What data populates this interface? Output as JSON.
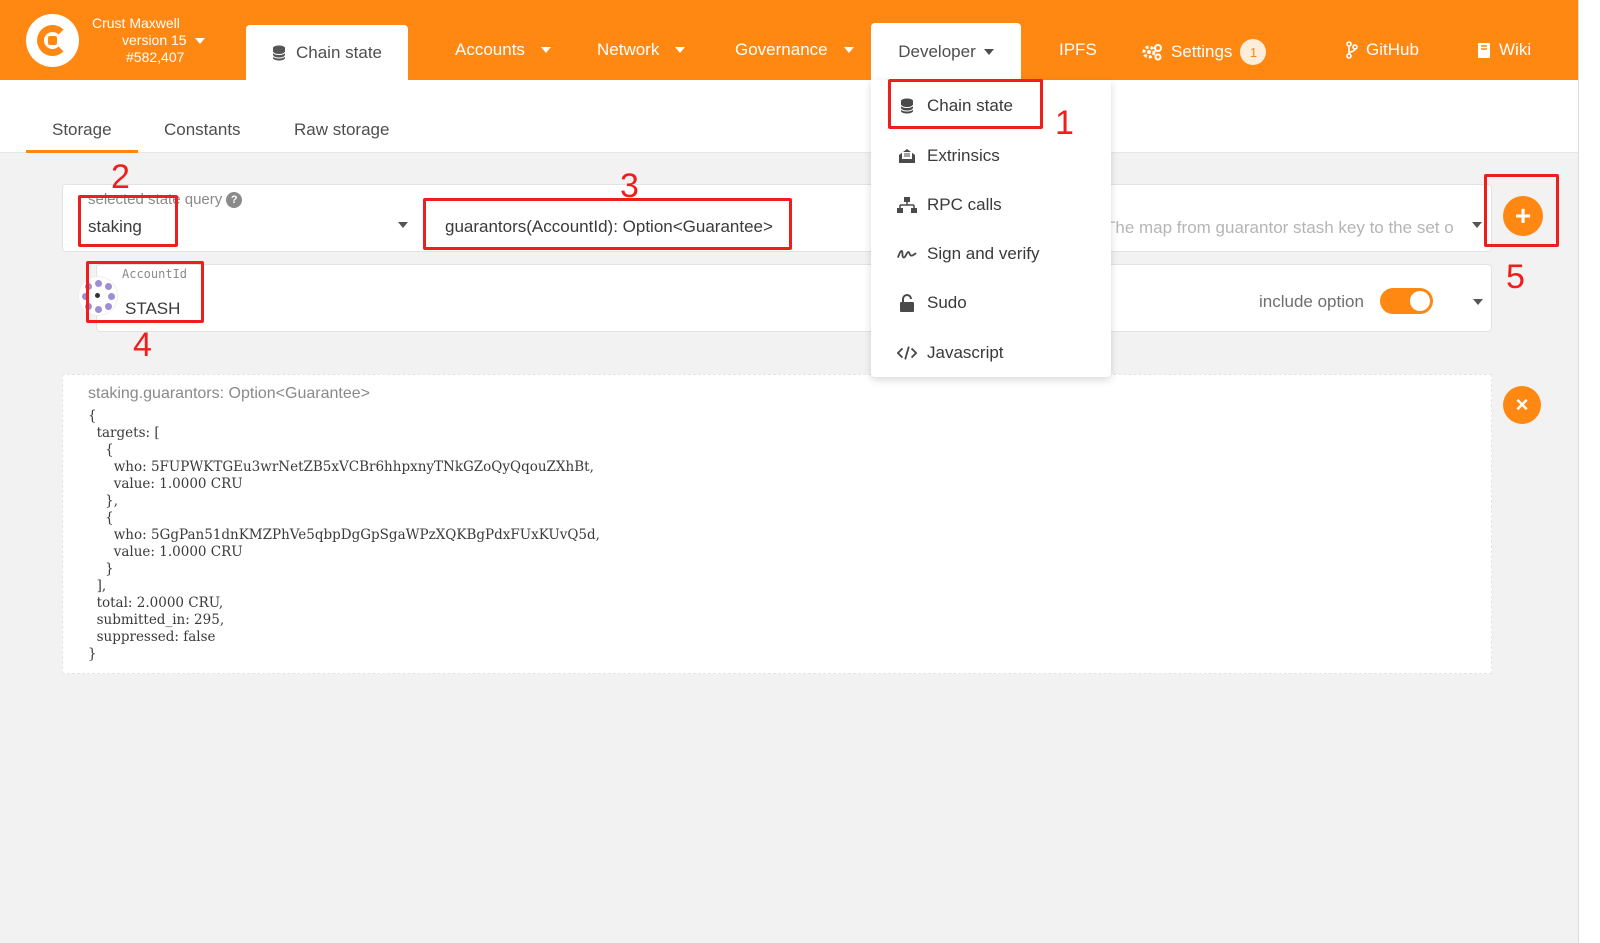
{
  "header": {
    "chain_name": "Crust Maxwell",
    "version": "version 15",
    "block": "#582,407",
    "active_tab": "Chain state",
    "menu": {
      "accounts": "Accounts",
      "network": "Network",
      "governance": "Governance",
      "developer": "Developer",
      "ipfs": "IPFS",
      "settings": "Settings",
      "settings_badge": "1",
      "github": "GitHub",
      "wiki": "Wiki"
    }
  },
  "subtabs": {
    "storage": "Storage",
    "constants": "Constants",
    "raw": "Raw storage"
  },
  "query": {
    "label": "selected state query",
    "help": "?",
    "module": "staking",
    "method": "guarantors(AccountId): Option<Guarantee>",
    "description": "The map from guarantor stash key to the set of stash keys of a..."
  },
  "param": {
    "label": "AccountId",
    "value": "STASH",
    "include_option_label": "include option",
    "include_option": true
  },
  "result": {
    "title": "staking.guarantors: Option<Guarantee>",
    "body": "{\n  targets: [\n    {\n      who: 5FUPWKTGEu3wrNetZB5xVCBr6hhpxnyTNkGZoQyQqouZXhBt,\n      value: 1.0000 CRU\n    },\n    {\n      who: 5GgPan51dnKMZPhVe5qbpDgGpSgaWPzXQKBgPdxFUxKUvQ5d,\n      value: 1.0000 CRU\n    }\n  ],\n  total: 2.0000 CRU,\n  submitted_in: 295,\n  suppressed: false\n}"
  },
  "dropdown": {
    "items": [
      "Chain state",
      "Extrinsics",
      "RPC calls",
      "Sign and verify",
      "Sudo",
      "Javascript"
    ]
  },
  "annotations": [
    "1",
    "2",
    "3",
    "4",
    "5"
  ],
  "colors": {
    "accent": "#ff8812",
    "annotation": "#f01d1d"
  }
}
